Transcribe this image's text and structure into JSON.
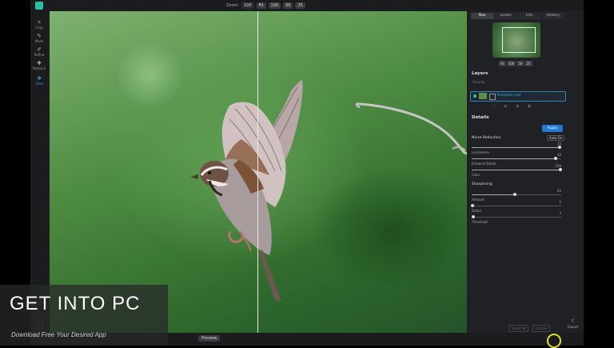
{
  "toolbar": {
    "zoom_label": "Zoom:",
    "zoom_value": "100",
    "zoom_buttons": [
      "Fit",
      "100",
      "50",
      "25"
    ]
  },
  "tools": [
    {
      "label": "Crop",
      "icon": "crop-icon"
    },
    {
      "label": "Mask",
      "icon": "mask-icon"
    },
    {
      "label": "Refine",
      "icon": "refine-icon"
    },
    {
      "label": "Retouch",
      "icon": "retouch-icon"
    },
    {
      "label": "View",
      "icon": "view-icon"
    }
  ],
  "panel": {
    "tabs": [
      "Nav",
      "Levels",
      "Info",
      "History"
    ],
    "active_tab": "Nav",
    "nav_buttons": [
      "Fit",
      "100",
      "50",
      "25"
    ],
    "layers_title": "Layers",
    "opacity_label": "Opacity",
    "layer_name": "Template.psd",
    "details_title": "Details",
    "apply_label": "Apply",
    "noise_reduction_title": "Noise Reduction",
    "auto_label": "Auto On",
    "sharpening_title": "Sharpening",
    "noise_sliders": [
      {
        "label": "Luminance",
        "value": "15",
        "level": 0.98
      },
      {
        "label": "Enhance Detail",
        "value": "10",
        "level": 0.94
      },
      {
        "label": "Color",
        "value": "100",
        "level": 0.99
      }
    ],
    "sharp_sliders": [
      {
        "label": "Amount",
        "value": "45",
        "level": 0.48
      },
      {
        "label": "Detail",
        "value": "1",
        "level": 0.01
      },
      {
        "label": "Threshold",
        "value": "3",
        "level": 0.02
      }
    ],
    "export_label": "Export",
    "reset_label": "Reset All",
    "cancel_label": "Cancel"
  },
  "statusbar": {
    "preview_label": "Preview"
  },
  "watermark": {
    "title": "GET INTO PC",
    "subtitle": "Download Free Your Desired App"
  }
}
